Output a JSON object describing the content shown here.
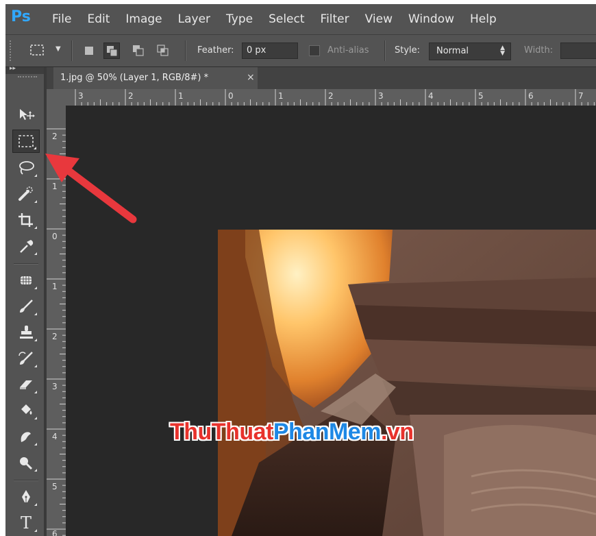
{
  "app": {
    "logo": "Ps",
    "menu": [
      "File",
      "Edit",
      "Image",
      "Layer",
      "Type",
      "Select",
      "Filter",
      "View",
      "Window",
      "Help"
    ]
  },
  "options": {
    "feather_label": "Feather:",
    "feather_value": "0 px",
    "antialias_label": "Anti-alias",
    "style_label": "Style:",
    "style_value": "Normal",
    "width_label": "Width:",
    "width_value": ""
  },
  "document": {
    "tab_title": "1.jpg @ 50% (Layer 1, RGB/8#) *",
    "close_glyph": "×"
  },
  "rulers": {
    "top": [
      "3",
      "2",
      "1",
      "0",
      "1",
      "2",
      "3",
      "4",
      "5",
      "6",
      "7"
    ],
    "left": [
      "2",
      "1",
      "0",
      "1",
      "2",
      "3",
      "4",
      "5",
      "6"
    ]
  },
  "toolbar": {
    "collapse_glyph": "▸▸",
    "tools": [
      {
        "name": "move-tool",
        "icon": "move-icon"
      },
      {
        "name": "rectangular-marquee-tool",
        "icon": "marquee-icon",
        "selected": true
      },
      {
        "name": "lasso-tool",
        "icon": "lasso-icon"
      },
      {
        "name": "quick-selection-tool",
        "icon": "quick-selection-icon"
      },
      {
        "name": "crop-tool",
        "icon": "crop-icon"
      },
      {
        "name": "eyedropper-tool",
        "icon": "eyedropper-icon"
      },
      {
        "name": "spot-healing-tool",
        "icon": "bandage-icon"
      },
      {
        "name": "brush-tool",
        "icon": "brush-icon"
      },
      {
        "name": "clone-stamp-tool",
        "icon": "stamp-icon"
      },
      {
        "name": "history-brush-tool",
        "icon": "history-brush-icon"
      },
      {
        "name": "eraser-tool",
        "icon": "eraser-icon"
      },
      {
        "name": "paint-bucket-tool",
        "icon": "paint-bucket-icon"
      },
      {
        "name": "blur-tool",
        "icon": "smudge-icon"
      },
      {
        "name": "dodge-tool",
        "icon": "dodge-icon"
      },
      {
        "name": "pen-tool",
        "icon": "pen-icon"
      },
      {
        "name": "type-tool",
        "icon": "type-icon",
        "glyph": "T"
      }
    ]
  },
  "watermark": {
    "part1": "ThuThuat",
    "part2": "PhanMem",
    "part3": ".vn"
  },
  "colors": {
    "ps_blue": "#31a8ff",
    "arrow_red": "#e8383d",
    "panel": "#535353",
    "canvas_bg": "#282828"
  }
}
